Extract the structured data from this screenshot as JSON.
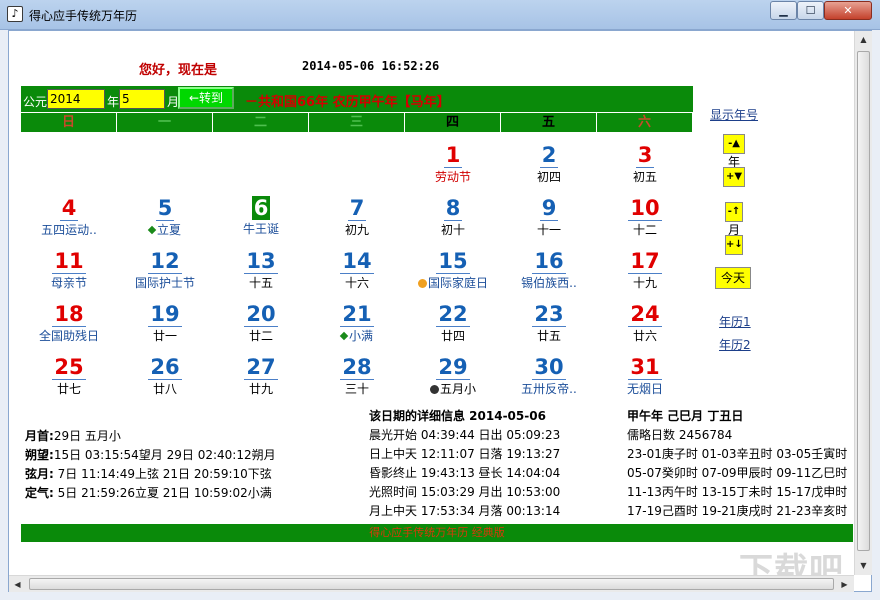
{
  "window": {
    "title": "得心应手传统万年历",
    "min": "▁",
    "max": "☐",
    "close": "✕"
  },
  "header": {
    "greeting": "您好，现在是",
    "datetime": "2014-05-06  16:52:26"
  },
  "nav": {
    "gongyuan_label": "公元",
    "year_value": "2014",
    "year_label": "年",
    "month_value": "5",
    "month_label": "月",
    "goto_label": "←转到",
    "year_info": "－共和国66年  农历甲午年【马年】"
  },
  "weekdays": [
    "日",
    "一",
    "二",
    "三",
    "四",
    "五",
    "六"
  ],
  "days": [
    {
      "n": "1",
      "sub": "劳动节",
      "c": "red",
      "s": "red",
      "col": 4,
      "row": 0
    },
    {
      "n": "2",
      "sub": "初四",
      "c": "blue",
      "s": "black",
      "col": 5,
      "row": 0
    },
    {
      "n": "3",
      "sub": "初五",
      "c": "red",
      "s": "black",
      "col": 6,
      "row": 0
    },
    {
      "n": "4",
      "sub": "五四运动..",
      "c": "red",
      "s": "blue",
      "col": 0,
      "row": 1
    },
    {
      "n": "5",
      "sub": "立夏",
      "c": "blue",
      "s": "blue",
      "col": 1,
      "row": 1,
      "mark": "diamond"
    },
    {
      "n": "6",
      "sub": "牛王诞",
      "c": "today",
      "s": "blue",
      "col": 2,
      "row": 1
    },
    {
      "n": "7",
      "sub": "初九",
      "c": "blue",
      "s": "black",
      "col": 3,
      "row": 1
    },
    {
      "n": "8",
      "sub": "初十",
      "c": "blue",
      "s": "black",
      "col": 4,
      "row": 1
    },
    {
      "n": "9",
      "sub": "十一",
      "c": "blue",
      "s": "black",
      "col": 5,
      "row": 1
    },
    {
      "n": "10",
      "sub": "十二",
      "c": "red",
      "s": "black",
      "col": 6,
      "row": 1
    },
    {
      "n": "11",
      "sub": "母亲节",
      "c": "red",
      "s": "blue",
      "col": 0,
      "row": 2
    },
    {
      "n": "12",
      "sub": "国际护士节",
      "c": "blue",
      "s": "blue",
      "col": 1,
      "row": 2
    },
    {
      "n": "13",
      "sub": "十五",
      "c": "blue",
      "s": "black",
      "col": 2,
      "row": 2
    },
    {
      "n": "14",
      "sub": "十六",
      "c": "blue",
      "s": "black",
      "col": 3,
      "row": 2
    },
    {
      "n": "15",
      "sub": "国际家庭日",
      "c": "blue",
      "s": "blue",
      "col": 4,
      "row": 2,
      "mark": "orange"
    },
    {
      "n": "16",
      "sub": "锡伯族西..",
      "c": "blue",
      "s": "blue",
      "col": 5,
      "row": 2
    },
    {
      "n": "17",
      "sub": "十九",
      "c": "red",
      "s": "black",
      "col": 6,
      "row": 2
    },
    {
      "n": "18",
      "sub": "全国助残日",
      "c": "red",
      "s": "blue",
      "col": 0,
      "row": 3
    },
    {
      "n": "19",
      "sub": "廿一",
      "c": "blue",
      "s": "black",
      "col": 1,
      "row": 3
    },
    {
      "n": "20",
      "sub": "廿二",
      "c": "blue",
      "s": "black",
      "col": 2,
      "row": 3
    },
    {
      "n": "21",
      "sub": "小满",
      "c": "blue",
      "s": "blue",
      "col": 3,
      "row": 3,
      "mark": "diamond"
    },
    {
      "n": "22",
      "sub": "廿四",
      "c": "blue",
      "s": "black",
      "col": 4,
      "row": 3
    },
    {
      "n": "23",
      "sub": "廿五",
      "c": "blue",
      "s": "black",
      "col": 5,
      "row": 3
    },
    {
      "n": "24",
      "sub": "廿六",
      "c": "red",
      "s": "black",
      "col": 6,
      "row": 3
    },
    {
      "n": "25",
      "sub": "廿七",
      "c": "red",
      "s": "black",
      "col": 0,
      "row": 4
    },
    {
      "n": "26",
      "sub": "廿八",
      "c": "blue",
      "s": "black",
      "col": 1,
      "row": 4
    },
    {
      "n": "27",
      "sub": "廿九",
      "c": "blue",
      "s": "black",
      "col": 2,
      "row": 4
    },
    {
      "n": "28",
      "sub": "三十",
      "c": "blue",
      "s": "black",
      "col": 3,
      "row": 4
    },
    {
      "n": "29",
      "sub": "五月小",
      "c": "blue",
      "s": "black",
      "col": 4,
      "row": 4,
      "mark": "dark"
    },
    {
      "n": "30",
      "sub": "五卅反帝..",
      "c": "blue",
      "s": "blue",
      "col": 5,
      "row": 4
    },
    {
      "n": "31",
      "sub": "无烟日",
      "c": "red",
      "s": "blue",
      "col": 6,
      "row": 4
    }
  ],
  "side": {
    "show_era": "显示年号",
    "year_up": "-▲",
    "year_label": "年",
    "year_down": "+▼",
    "month_up": "-↑",
    "month_label": "月",
    "month_down": "+↓",
    "today": "今天",
    "yearly1": "年历1",
    "yearly2": "年历2"
  },
  "lunar_left": [
    {
      "k": "月首:",
      "v": "29日 五月小"
    },
    {
      "k": "朔望:",
      "v": "15日 03:15:54望月   29日 02:40:12朔月"
    },
    {
      "k": "弦月:",
      "v": " 7日 11:14:49上弦   21日 20:59:10下弦"
    },
    {
      "k": "定气:",
      "v": " 5日 21:59:26立夏   21日 10:59:02小满"
    }
  ],
  "detail": {
    "heading": "该日期的详细信息  2014-05-06",
    "rows": [
      "晨光开始 04:39:44 日出 05:09:23",
      "日上中天 12:11:07 日落 19:13:27",
      "昏影终止 19:43:13 昼长 14:04:04",
      "光照时间 15:03:29 月出 10:53:00",
      "月上中天 17:53:34 月落 00:13:14"
    ]
  },
  "ganzhi": {
    "heading": "甲午年  己巳月  丁丑日",
    "rows": [
      "儒略日数 2456784",
      "23-01庚子时 01-03辛丑时 03-05壬寅时",
      "05-07癸卯时 07-09甲辰时 09-11乙巳时",
      "11-13丙午时 13-15丁未时 15-17戊申时",
      "17-19己酉时 19-21庚戌时 21-23辛亥时"
    ]
  },
  "footer": {
    "text": "得心应手传统万年历 经典版"
  },
  "watermark": "下载吧"
}
